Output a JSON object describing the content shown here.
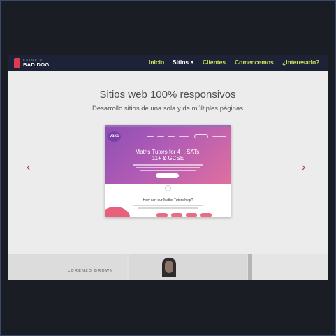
{
  "navbar": {
    "logo_sub": "ESTUDIO",
    "logo_main": "BAD DOG",
    "items": [
      {
        "label": "Inicio",
        "active": false
      },
      {
        "label": "Sitios",
        "active": true,
        "dropdown": true
      },
      {
        "label": "Clientes",
        "active": false
      },
      {
        "label": "Comencemos",
        "active": false
      },
      {
        "label": "¿Interesado?",
        "active": false
      }
    ],
    "dropdown_caret": "▼"
  },
  "hero": {
    "title": "Sitios web 100% responsivos",
    "subtitle": "Desarrollo sitios de una sola y de múltiples páginas"
  },
  "carousel": {
    "prev_icon": "‹",
    "next_icon": "›",
    "slide": {
      "logo": "vaks",
      "headline_line1": "Maths Tutors for 4+, SATs,",
      "headline_line2": "11+ & GCSE",
      "download_icon": "↓",
      "question": "How can our Maths Tutors help?"
    }
  },
  "strip": {
    "name_text": "LORENZO BROWN"
  },
  "colors": {
    "navbar_bg": "#1d2236",
    "nav_link": "#c9e05b",
    "accent": "#b0334c"
  }
}
